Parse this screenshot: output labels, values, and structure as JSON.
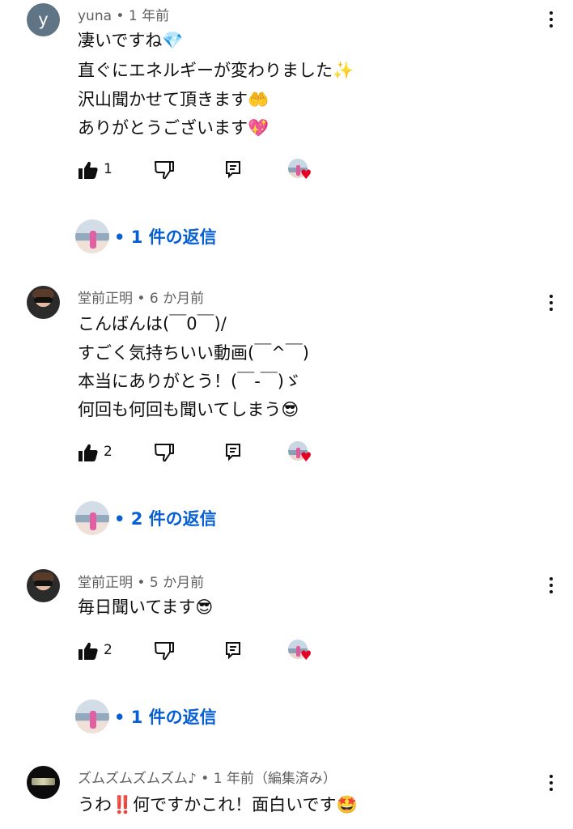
{
  "comments": [
    {
      "author": "yuna",
      "time": "1 年前",
      "avatar_letter": "y",
      "lines": [
        "凄いですね💎",
        "直ぐにエネルギーが変わりました✨",
        "沢山聞かせて頂きます🤲",
        "ありがとうございます💖"
      ],
      "likes": "1",
      "replies": "1 件の返信"
    },
    {
      "author": "堂前正明",
      "time": "6 か月前",
      "lines": [
        "こんばんは(￣0￣)/",
        "すごく気持ちいい動画(￣^￣)",
        "本当にありがとう！(￣-￣)ゞ",
        "何回も何回も聞いてしまう😎"
      ],
      "likes": "2",
      "replies": "2 件の返信"
    },
    {
      "author": "堂前正明",
      "time": "5 か月前",
      "lines": [
        "毎日聞いてます😎"
      ],
      "likes": "2",
      "replies": "1 件の返信"
    },
    {
      "author": "ズムズムズムズム♪",
      "time": "1 年前（編集済み）",
      "lines": [
        "うわ‼️何ですかこれ！面白いです🤩"
      ]
    }
  ],
  "separator": " • ",
  "icons": {
    "like": "thumbs-up-icon",
    "dislike": "thumbs-down-icon",
    "reply": "reply-icon",
    "more": "more-vert-icon",
    "creator_heart": "creator-heart-icon"
  },
  "colors": {
    "link": "#065fd4",
    "meta": "#606060",
    "text": "#0f0f0f",
    "heart": "#e60023"
  }
}
